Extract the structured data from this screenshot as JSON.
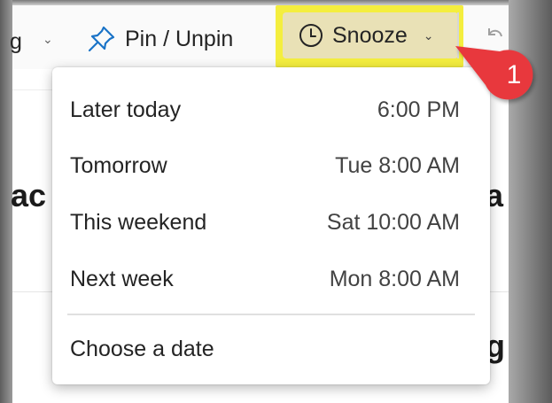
{
  "toolbar": {
    "partial_button_label": "g",
    "pin_label": "Pin / Unpin",
    "snooze_label": "Snooze"
  },
  "content": {
    "partial_left": "ac",
    "partial_right_1": "a",
    "partial_right_2": "g"
  },
  "annotation": {
    "badge_number": "1",
    "color": "#e8373d"
  },
  "highlight_color": "#f4ee3e",
  "snooze_menu": {
    "items": [
      {
        "label": "Later today",
        "time": "6:00 PM"
      },
      {
        "label": "Tomorrow",
        "time": "Tue 8:00 AM"
      },
      {
        "label": "This weekend",
        "time": "Sat 10:00 AM"
      },
      {
        "label": "Next week",
        "time": "Mon 8:00 AM"
      }
    ],
    "choose_date_label": "Choose a date"
  }
}
